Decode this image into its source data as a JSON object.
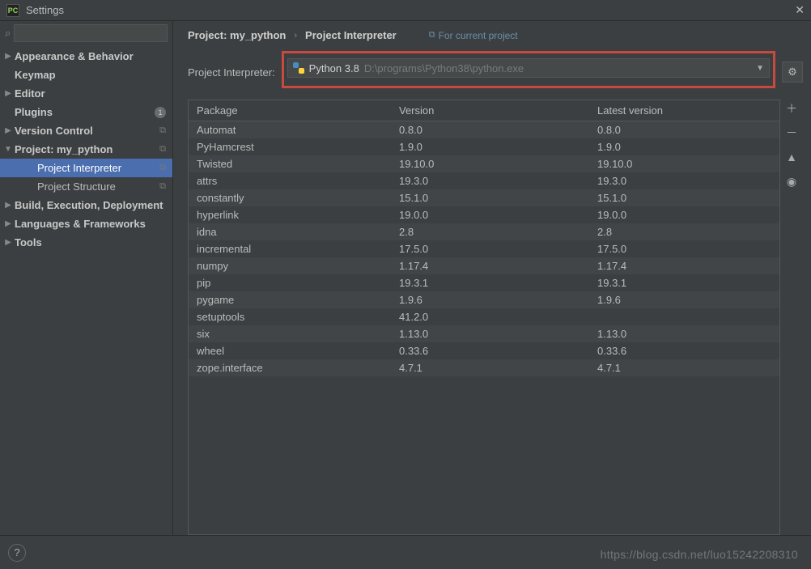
{
  "window": {
    "title": "Settings",
    "logo_text": "PC"
  },
  "search": {
    "placeholder": ""
  },
  "sidebar": {
    "items": [
      {
        "label": "Appearance & Behavior",
        "arrow": "▶",
        "bold": true
      },
      {
        "label": "Keymap",
        "arrow": "",
        "bold": true
      },
      {
        "label": "Editor",
        "arrow": "▶",
        "bold": true
      },
      {
        "label": "Plugins",
        "arrow": "",
        "bold": true,
        "badge": "1"
      },
      {
        "label": "Version Control",
        "arrow": "▶",
        "bold": true,
        "copy": true
      },
      {
        "label": "Project: my_python",
        "arrow": "▼",
        "bold": true,
        "copy": true
      },
      {
        "label": "Project Interpreter",
        "arrow": "",
        "bold": false,
        "sub": true,
        "selected": true,
        "copy": true
      },
      {
        "label": "Project Structure",
        "arrow": "",
        "bold": false,
        "sub": true,
        "copy": true
      },
      {
        "label": "Build, Execution, Deployment",
        "arrow": "▶",
        "bold": true
      },
      {
        "label": "Languages & Frameworks",
        "arrow": "▶",
        "bold": true
      },
      {
        "label": "Tools",
        "arrow": "▶",
        "bold": true
      }
    ]
  },
  "breadcrumb": {
    "crumb1": "Project: my_python",
    "crumb2": "Project Interpreter",
    "for_project": "For current project"
  },
  "interpreter": {
    "label": "Project Interpreter:",
    "name": "Python 3.8",
    "path": "D:\\programs\\Python38\\python.exe"
  },
  "table": {
    "headers": {
      "c1": "Package",
      "c2": "Version",
      "c3": "Latest version"
    },
    "rows": [
      {
        "c1": "Automat",
        "c2": "0.8.0",
        "c3": "0.8.0"
      },
      {
        "c1": "PyHamcrest",
        "c2": "1.9.0",
        "c3": "1.9.0"
      },
      {
        "c1": "Twisted",
        "c2": "19.10.0",
        "c3": "19.10.0"
      },
      {
        "c1": "attrs",
        "c2": "19.3.0",
        "c3": "19.3.0"
      },
      {
        "c1": "constantly",
        "c2": "15.1.0",
        "c3": "15.1.0"
      },
      {
        "c1": "hyperlink",
        "c2": "19.0.0",
        "c3": "19.0.0"
      },
      {
        "c1": "idna",
        "c2": "2.8",
        "c3": "2.8"
      },
      {
        "c1": "incremental",
        "c2": "17.5.0",
        "c3": "17.5.0"
      },
      {
        "c1": "numpy",
        "c2": "1.17.4",
        "c3": "1.17.4"
      },
      {
        "c1": "pip",
        "c2": "19.3.1",
        "c3": "19.3.1"
      },
      {
        "c1": "pygame",
        "c2": "1.9.6",
        "c3": "1.9.6"
      },
      {
        "c1": "setuptools",
        "c2": "41.2.0",
        "c3": ""
      },
      {
        "c1": "six",
        "c2": "1.13.0",
        "c3": "1.13.0"
      },
      {
        "c1": "wheel",
        "c2": "0.33.6",
        "c3": "0.33.6"
      },
      {
        "c1": "zope.interface",
        "c2": "4.7.1",
        "c3": "4.7.1"
      }
    ]
  },
  "watermark": "https://blog.csdn.net/luo15242208310"
}
